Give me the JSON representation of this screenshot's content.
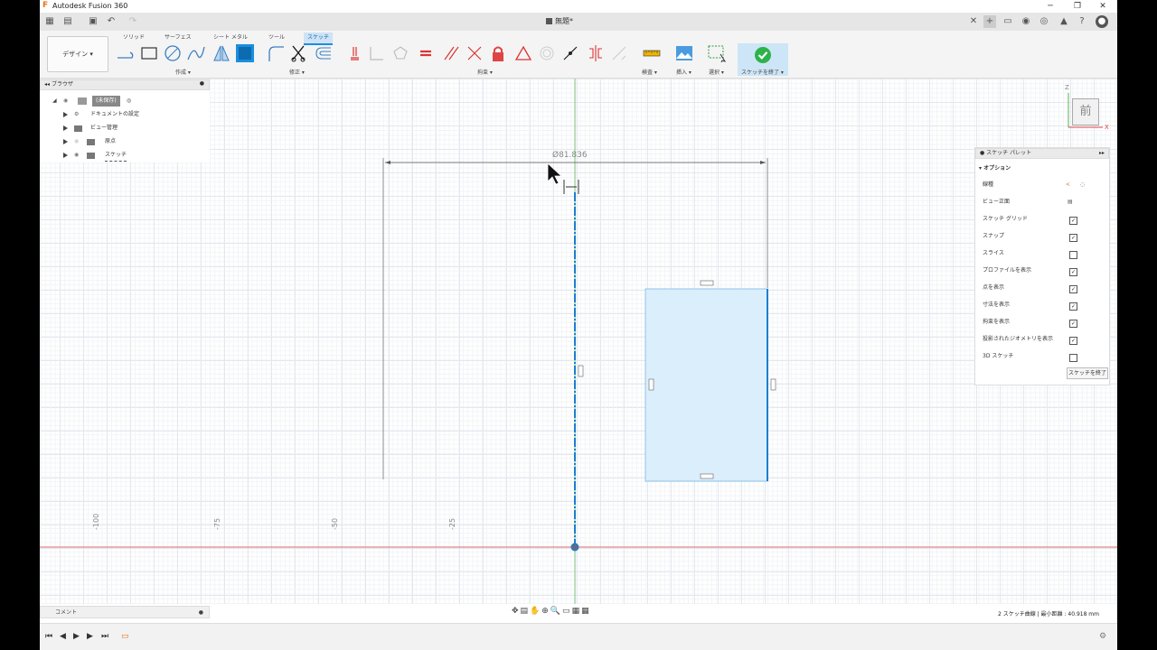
{
  "app": {
    "title": "Autodesk Fusion 360",
    "doc_title": "無題*"
  },
  "window_controls": {
    "minimize": "─",
    "restore": "❐",
    "close": "✕"
  },
  "toolbar": {
    "workspace": "デザイン ▾",
    "tabs": [
      {
        "label": "ソリッド",
        "active": false
      },
      {
        "label": "サーフェス",
        "active": false
      },
      {
        "label": "シート メタル",
        "active": false
      },
      {
        "label": "ツール",
        "active": false
      },
      {
        "label": "スケッチ",
        "active": true
      }
    ],
    "groups": {
      "create": "作成 ▾",
      "modify": "修正 ▾",
      "constraints": "拘束 ▾",
      "inspect": "検査 ▾",
      "insert": "挿入 ▾",
      "select": "選択 ▾",
      "finish": "スケッチを終了 ▾"
    }
  },
  "browser": {
    "title": "ブラウザ",
    "items": [
      {
        "label": "(未保存)"
      },
      {
        "label": "ドキュメントの設定"
      },
      {
        "label": "ビュー管理"
      },
      {
        "label": "原点"
      },
      {
        "label": "スケッチ"
      }
    ]
  },
  "comment": {
    "label": "コメント"
  },
  "viewcube": {
    "face": "前",
    "axis_z": "Z",
    "axis_x": "X"
  },
  "canvas": {
    "dimension": "Ø81.836",
    "rulers": [
      "-100",
      "-75",
      "-50",
      "-25"
    ]
  },
  "palette": {
    "title": "スケッチ パレット",
    "section": "オプション",
    "rows": [
      {
        "label": "線種",
        "state": "icons"
      },
      {
        "label": "ビュー正面",
        "state": "icon"
      },
      {
        "label": "スケッチ グリッド",
        "state": "checked"
      },
      {
        "label": "スナップ",
        "state": "checked"
      },
      {
        "label": "スライス",
        "state": "unchecked"
      },
      {
        "label": "プロファイルを表示",
        "state": "checked"
      },
      {
        "label": "点を表示",
        "state": "checked"
      },
      {
        "label": "寸法を表示",
        "state": "checked"
      },
      {
        "label": "拘束を表示",
        "state": "checked"
      },
      {
        "label": "投影されたジオメトリを表示",
        "state": "checked"
      },
      {
        "label": "3D スケッチ",
        "state": "unchecked"
      }
    ],
    "finish_button": "スケッチを終了"
  },
  "status": {
    "text": "2 スケッチ曲線 | 最小距離 : 40.918 mm"
  },
  "colors": {
    "accent": "#1a8ee0",
    "profile_fill": "#dbeefb",
    "x_axis": "#e06a6a",
    "y_axis": "#7fc37f",
    "finish_green": "#2db34a"
  }
}
